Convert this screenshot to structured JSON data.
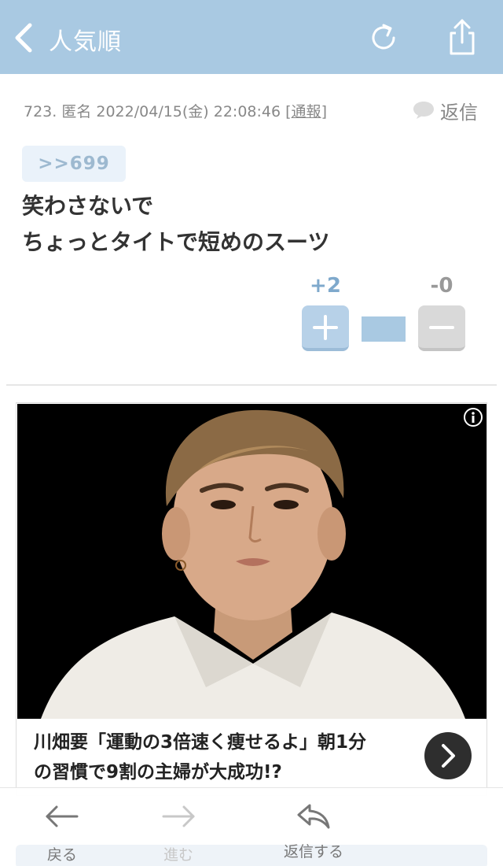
{
  "header": {
    "title": "人気順",
    "bg_color": "#a9c9e2"
  },
  "comment": {
    "meta_prefix": "723. 匿名 2022/04/15(金) 22:08:46 [",
    "report_label": "通報",
    "meta_suffix": "]",
    "reply_label": "返信",
    "anchor": ">>699",
    "body_lines": [
      "笑わさないで",
      "ちょっとタイトで短めのスーツ"
    ],
    "votes": {
      "plus_count": "+2",
      "minus_count": "-0",
      "plus_ratio": 1.0
    }
  },
  "ad": {
    "title_line1": "川畑要「運動の3倍速く痩せるよ」朝1分",
    "title_line2": "の習慣で9割の主婦が大成功!?"
  },
  "bottom_nav": {
    "back_label": "戻る",
    "forward_label": "進む",
    "reply_label": "返信する"
  },
  "icons": {
    "back": "chevron-left-icon",
    "reload": "reload-icon",
    "share": "share-icon",
    "reply_bubble": "speech-bubble-icon",
    "info": "info-icon",
    "ad_arrow": "chevron-right-icon",
    "nav_back": "arrow-left-icon",
    "nav_forward": "arrow-right-icon",
    "nav_reply": "reply-arrow-icon"
  }
}
